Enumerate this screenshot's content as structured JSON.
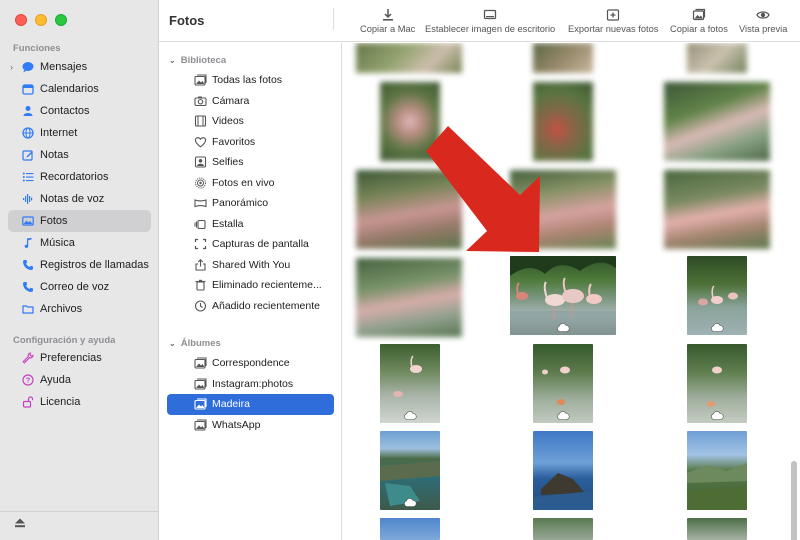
{
  "sidebar": {
    "section_features": "Funciones",
    "features": [
      {
        "label": "Mensajes",
        "icon": "message-bubble-icon",
        "color": "#2f7cf6"
      },
      {
        "label": "Calendarios",
        "icon": "calendar-icon",
        "color": "#2f7cf6"
      },
      {
        "label": "Contactos",
        "icon": "person-icon",
        "color": "#2f7cf6"
      },
      {
        "label": "Internet",
        "icon": "globe-icon",
        "color": "#2f7cf6"
      },
      {
        "label": "Notas",
        "icon": "note-edit-icon",
        "color": "#2f7cf6"
      },
      {
        "label": "Recordatorios",
        "icon": "list-icon",
        "color": "#2f7cf6"
      },
      {
        "label": "Notas de voz",
        "icon": "waveform-icon",
        "color": "#2f7cf6"
      },
      {
        "label": "Fotos",
        "icon": "photo-icon",
        "color": "#2f7cf6"
      },
      {
        "label": "Música",
        "icon": "music-note-icon",
        "color": "#2f7cf6"
      },
      {
        "label": "Registros de llamadas",
        "icon": "phone-icon",
        "color": "#2f7cf6"
      },
      {
        "label": "Correo de voz",
        "icon": "voicemail-icon",
        "color": "#2f7cf6"
      },
      {
        "label": "Archivos",
        "icon": "folder-icon",
        "color": "#2f7cf6"
      }
    ],
    "section_settings": "Configuración y ayuda",
    "settings": [
      {
        "label": "Preferencias",
        "icon": "wrench-icon",
        "color": "#c63fc4"
      },
      {
        "label": "Ayuda",
        "icon": "question-circle-icon",
        "color": "#c63fc4"
      },
      {
        "label": "Licencia",
        "icon": "lock-open-icon",
        "color": "#c63fc4"
      }
    ]
  },
  "toolbar": {
    "title": "Fotos",
    "buttons": [
      {
        "label": "Copiar a Mac",
        "icon": "download-icon"
      },
      {
        "label": "Establecer imagen de escritorio",
        "icon": "desktop-icon"
      },
      {
        "label": "Exportar nuevas fotos",
        "icon": "export-plus-icon"
      },
      {
        "label": "Copiar a fotos",
        "icon": "photos-copy-icon"
      },
      {
        "label": "Vista previa",
        "icon": "eye-icon"
      }
    ]
  },
  "library": {
    "section": "Biblioteca",
    "items": [
      {
        "label": "Todas las fotos",
        "icon": "photos-stack-icon"
      },
      {
        "label": "Cámara",
        "icon": "camera-icon"
      },
      {
        "label": "Videos",
        "icon": "film-icon"
      },
      {
        "label": "Favoritos",
        "icon": "heart-icon"
      },
      {
        "label": "Selfies",
        "icon": "selfie-icon"
      },
      {
        "label": "Fotos en vivo",
        "icon": "live-photo-icon"
      },
      {
        "label": "Panorámico",
        "icon": "panorama-icon"
      },
      {
        "label": "Estalla",
        "icon": "burst-icon"
      },
      {
        "label": "Capturas de pantalla",
        "icon": "screenshot-icon"
      },
      {
        "label": "Shared With You",
        "icon": "share-icon"
      },
      {
        "label": "Eliminado recienteme...",
        "icon": "trash-icon"
      },
      {
        "label": "Añadido recientemente",
        "icon": "clock-icon"
      }
    ]
  },
  "albums": {
    "section": "Álbumes",
    "items": [
      {
        "label": "Correspondence",
        "icon": "album-icon",
        "selected": false
      },
      {
        "label": "Instagram:photos",
        "icon": "album-icon",
        "selected": false
      },
      {
        "label": "Madeira",
        "icon": "album-icon",
        "selected": true
      },
      {
        "label": "WhatsApp",
        "icon": "album-icon",
        "selected": false
      }
    ]
  },
  "colors": {
    "accent": "#2f6ddb",
    "arrow": "#d9291e",
    "sidebar_bg": "#e8e7e8"
  }
}
